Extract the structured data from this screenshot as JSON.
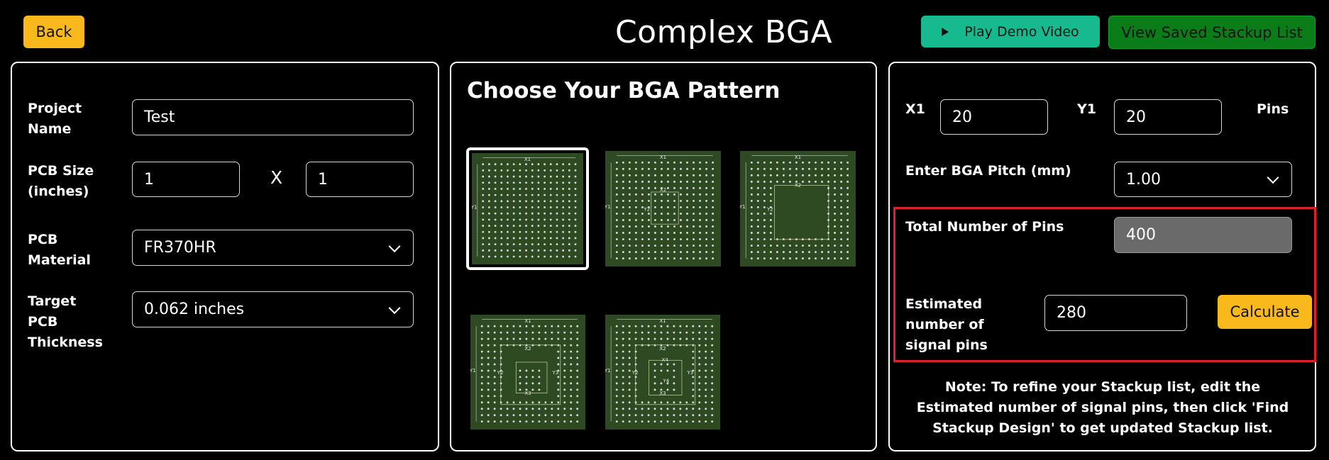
{
  "header": {
    "back_label": "Back",
    "title": "Complex BGA",
    "demo_label": "Play Demo Video",
    "saved_label": "View Saved Stackup List"
  },
  "left": {
    "project_name_label": "Project Name",
    "project_name_value": "Test",
    "pcb_size_label": "PCB Size (inches)",
    "pcb_size_x": "1",
    "pcb_size_sep": "X",
    "pcb_size_y": "1",
    "material_label": "PCB Material",
    "material_value": "FR370HR",
    "thickness_label": "Target PCB Thickness",
    "thickness_value": "0.062 inches"
  },
  "middle": {
    "heading": "Choose Your BGA Pattern",
    "patterns": [
      {
        "labels": [
          "X1",
          "Y1"
        ],
        "selected": true
      },
      {
        "labels": [
          "X1",
          "Y1",
          "X2",
          "Y2"
        ],
        "selected": false
      },
      {
        "labels": [
          "X1",
          "Y1",
          "X2",
          "Y2"
        ],
        "selected": false
      },
      {
        "labels": [
          "X1",
          "Y1",
          "X2",
          "Y2",
          "X3",
          "Y3"
        ],
        "selected": false
      },
      {
        "labels": [
          "X1",
          "Y1",
          "X2",
          "Y2",
          "X3",
          "Y3",
          "X4",
          "Y4"
        ],
        "selected": false
      }
    ]
  },
  "right": {
    "x1_label": "X1",
    "x1_value": "20",
    "y1_label": "Y1",
    "y1_value": "20",
    "pins_label": "Pins",
    "pitch_label": "Enter BGA Pitch (mm)",
    "pitch_value": "1.00",
    "total_pins_label": "Total Number of Pins",
    "total_pins_value": "400",
    "signal_pins_label": "Estimated number of signal pins",
    "signal_pins_value": "280",
    "calculate_label": "Calculate",
    "note": "Note: To refine your Stackup list, edit the Estimated number of signal pins, then click 'Find Stackup Design' to get updated Stackup list."
  },
  "colors": {
    "accent_yellow": "#f9b91c",
    "teal": "#17b98f",
    "green": "#0a7d18",
    "highlight_red": "#e0202a",
    "bga_board": "#2d4a22"
  }
}
